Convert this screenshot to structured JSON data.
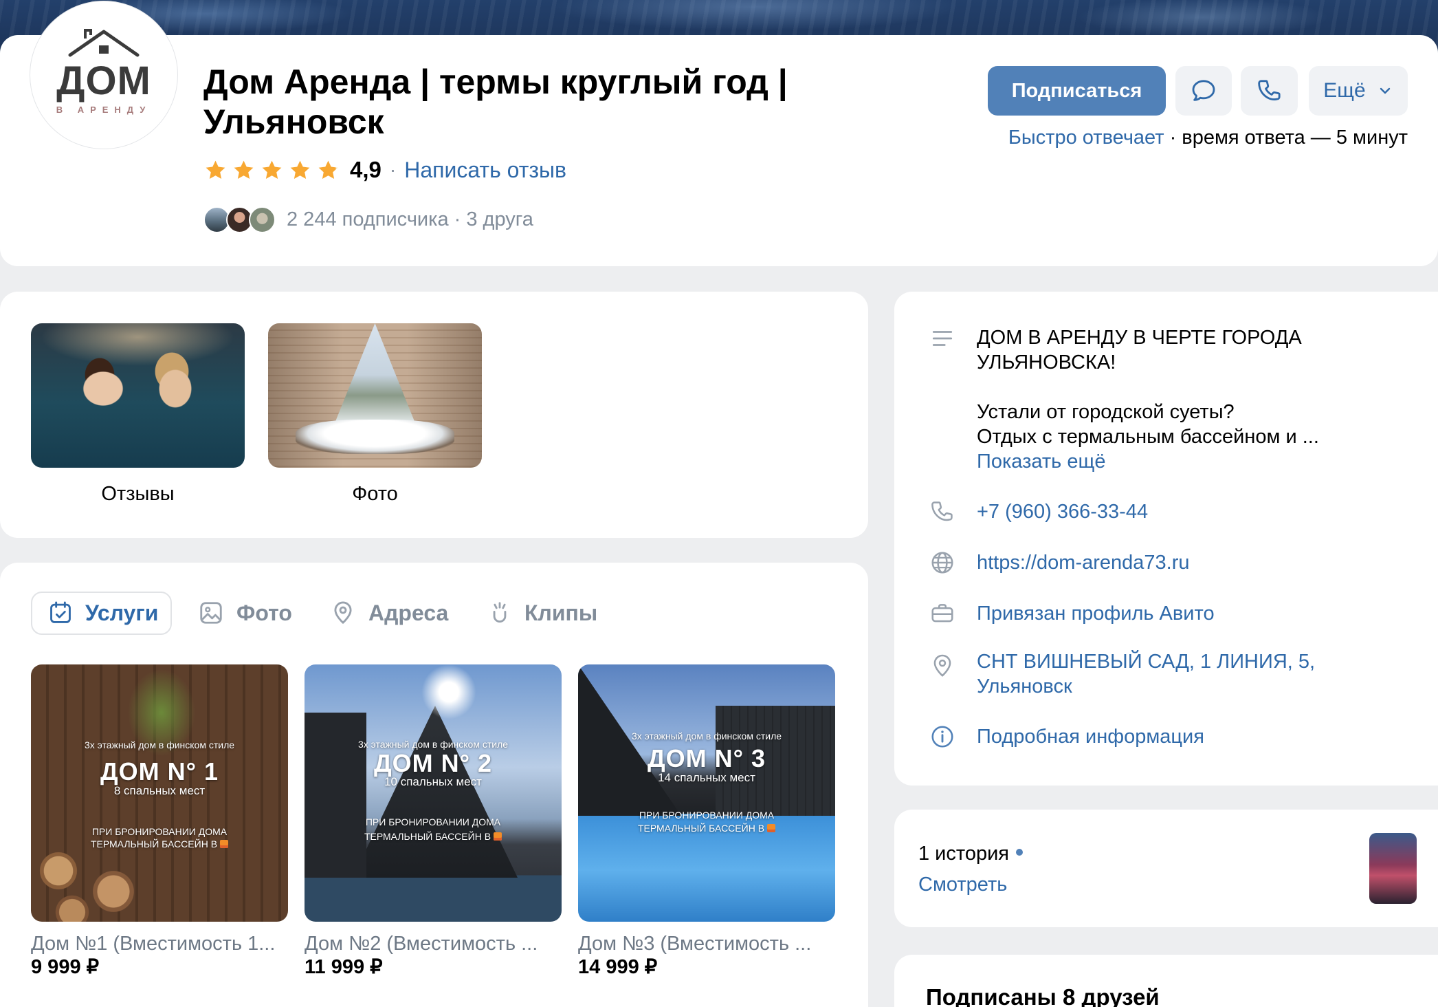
{
  "colors": {
    "page": "#edeef0",
    "card": "#ffffff",
    "accent": "#5181b8",
    "link": "#2f69a9",
    "grey": "#818c99",
    "icon_grey": "#99a2ad",
    "star": "#f8a832",
    "star_empty": "#f3e2b8"
  },
  "header": {
    "logo": {
      "main": "ДОМ",
      "sub": "В АРЕНДУ"
    },
    "title": "Дом Аренда | термы круглый год | Ульяновск",
    "rating": {
      "value": "4,9",
      "stars": 4.9,
      "separator": "·",
      "write_review": "Написать отзыв"
    },
    "subscribers": "2 244 подписчика · 3 друга",
    "actions": {
      "subscribe": "Подписаться",
      "more": "Ещё",
      "message_icon": "message-icon",
      "phone_icon": "phone-icon"
    },
    "response": {
      "fast": "Быстро отвечает",
      "rest": " · время ответа — 5 минут"
    }
  },
  "highlights": [
    {
      "label": "Отзывы"
    },
    {
      "label": "Фото"
    }
  ],
  "tabs": [
    {
      "label": "Услуги",
      "icon": "calendar-check-icon",
      "selected": true
    },
    {
      "label": "Фото",
      "icon": "image-icon",
      "selected": false
    },
    {
      "label": "Адреса",
      "icon": "map-pin-icon",
      "selected": false
    },
    {
      "label": "Клипы",
      "icon": "clips-icon",
      "selected": false
    }
  ],
  "products": [
    {
      "name": "Дом №1 (Вместимость 1...",
      "price": "9 999 ₽",
      "overlay": {
        "subtitle": "3х этажный дом в финском стиле",
        "title": "ДОМ N° 1",
        "beds": "8 спальных мест",
        "promo1": "ПРИ БРОНИРОВАНИИ ДОМА",
        "promo2": "ТЕРМАЛЬНЫЙ БАССЕЙН В"
      }
    },
    {
      "name": "Дом №2 (Вместимость ...",
      "price": "11 999 ₽",
      "overlay": {
        "subtitle": "3х этажный дом в финском стиле",
        "title": "ДОМ N° 2",
        "beds": "10 спальных мест",
        "promo1": "ПРИ БРОНИРОВАНИИ ДОМА",
        "promo2": "ТЕРМАЛЬНЫЙ БАССЕЙН В"
      }
    },
    {
      "name": "Дом №3 (Вместимость ...",
      "price": "14 999 ₽",
      "overlay": {
        "subtitle": "3х этажный дом в финском стиле",
        "title": "ДОМ N° 3",
        "beds": "14 спальных мест",
        "promo1": "ПРИ БРОНИРОВАНИИ ДОМА",
        "promo2": "ТЕРМАЛЬНЫЙ БАССЕЙН В"
      }
    }
  ],
  "info": {
    "description": [
      "ДОМ В АРЕНДУ В ЧЕРТЕ ГОРОДА",
      "УЛЬЯНОВСКА!",
      "Устали от городской суеты?",
      "Отдых с термальным бассейном и ..."
    ],
    "show_more": "Показать ещё",
    "phone": "+7 (960) 366-33-44",
    "website": "https://dom-arenda73.ru",
    "avito": "Привязан профиль Авито",
    "address": [
      "СНТ ВИШНЕВЫЙ САД, 1 ЛИНИЯ, 5,",
      "Ульяновск"
    ],
    "details": "Подробная информация"
  },
  "stories": {
    "count": "1 история",
    "view": "Смотреть"
  },
  "friends": {
    "heading": "Подписаны 8 друзей"
  }
}
